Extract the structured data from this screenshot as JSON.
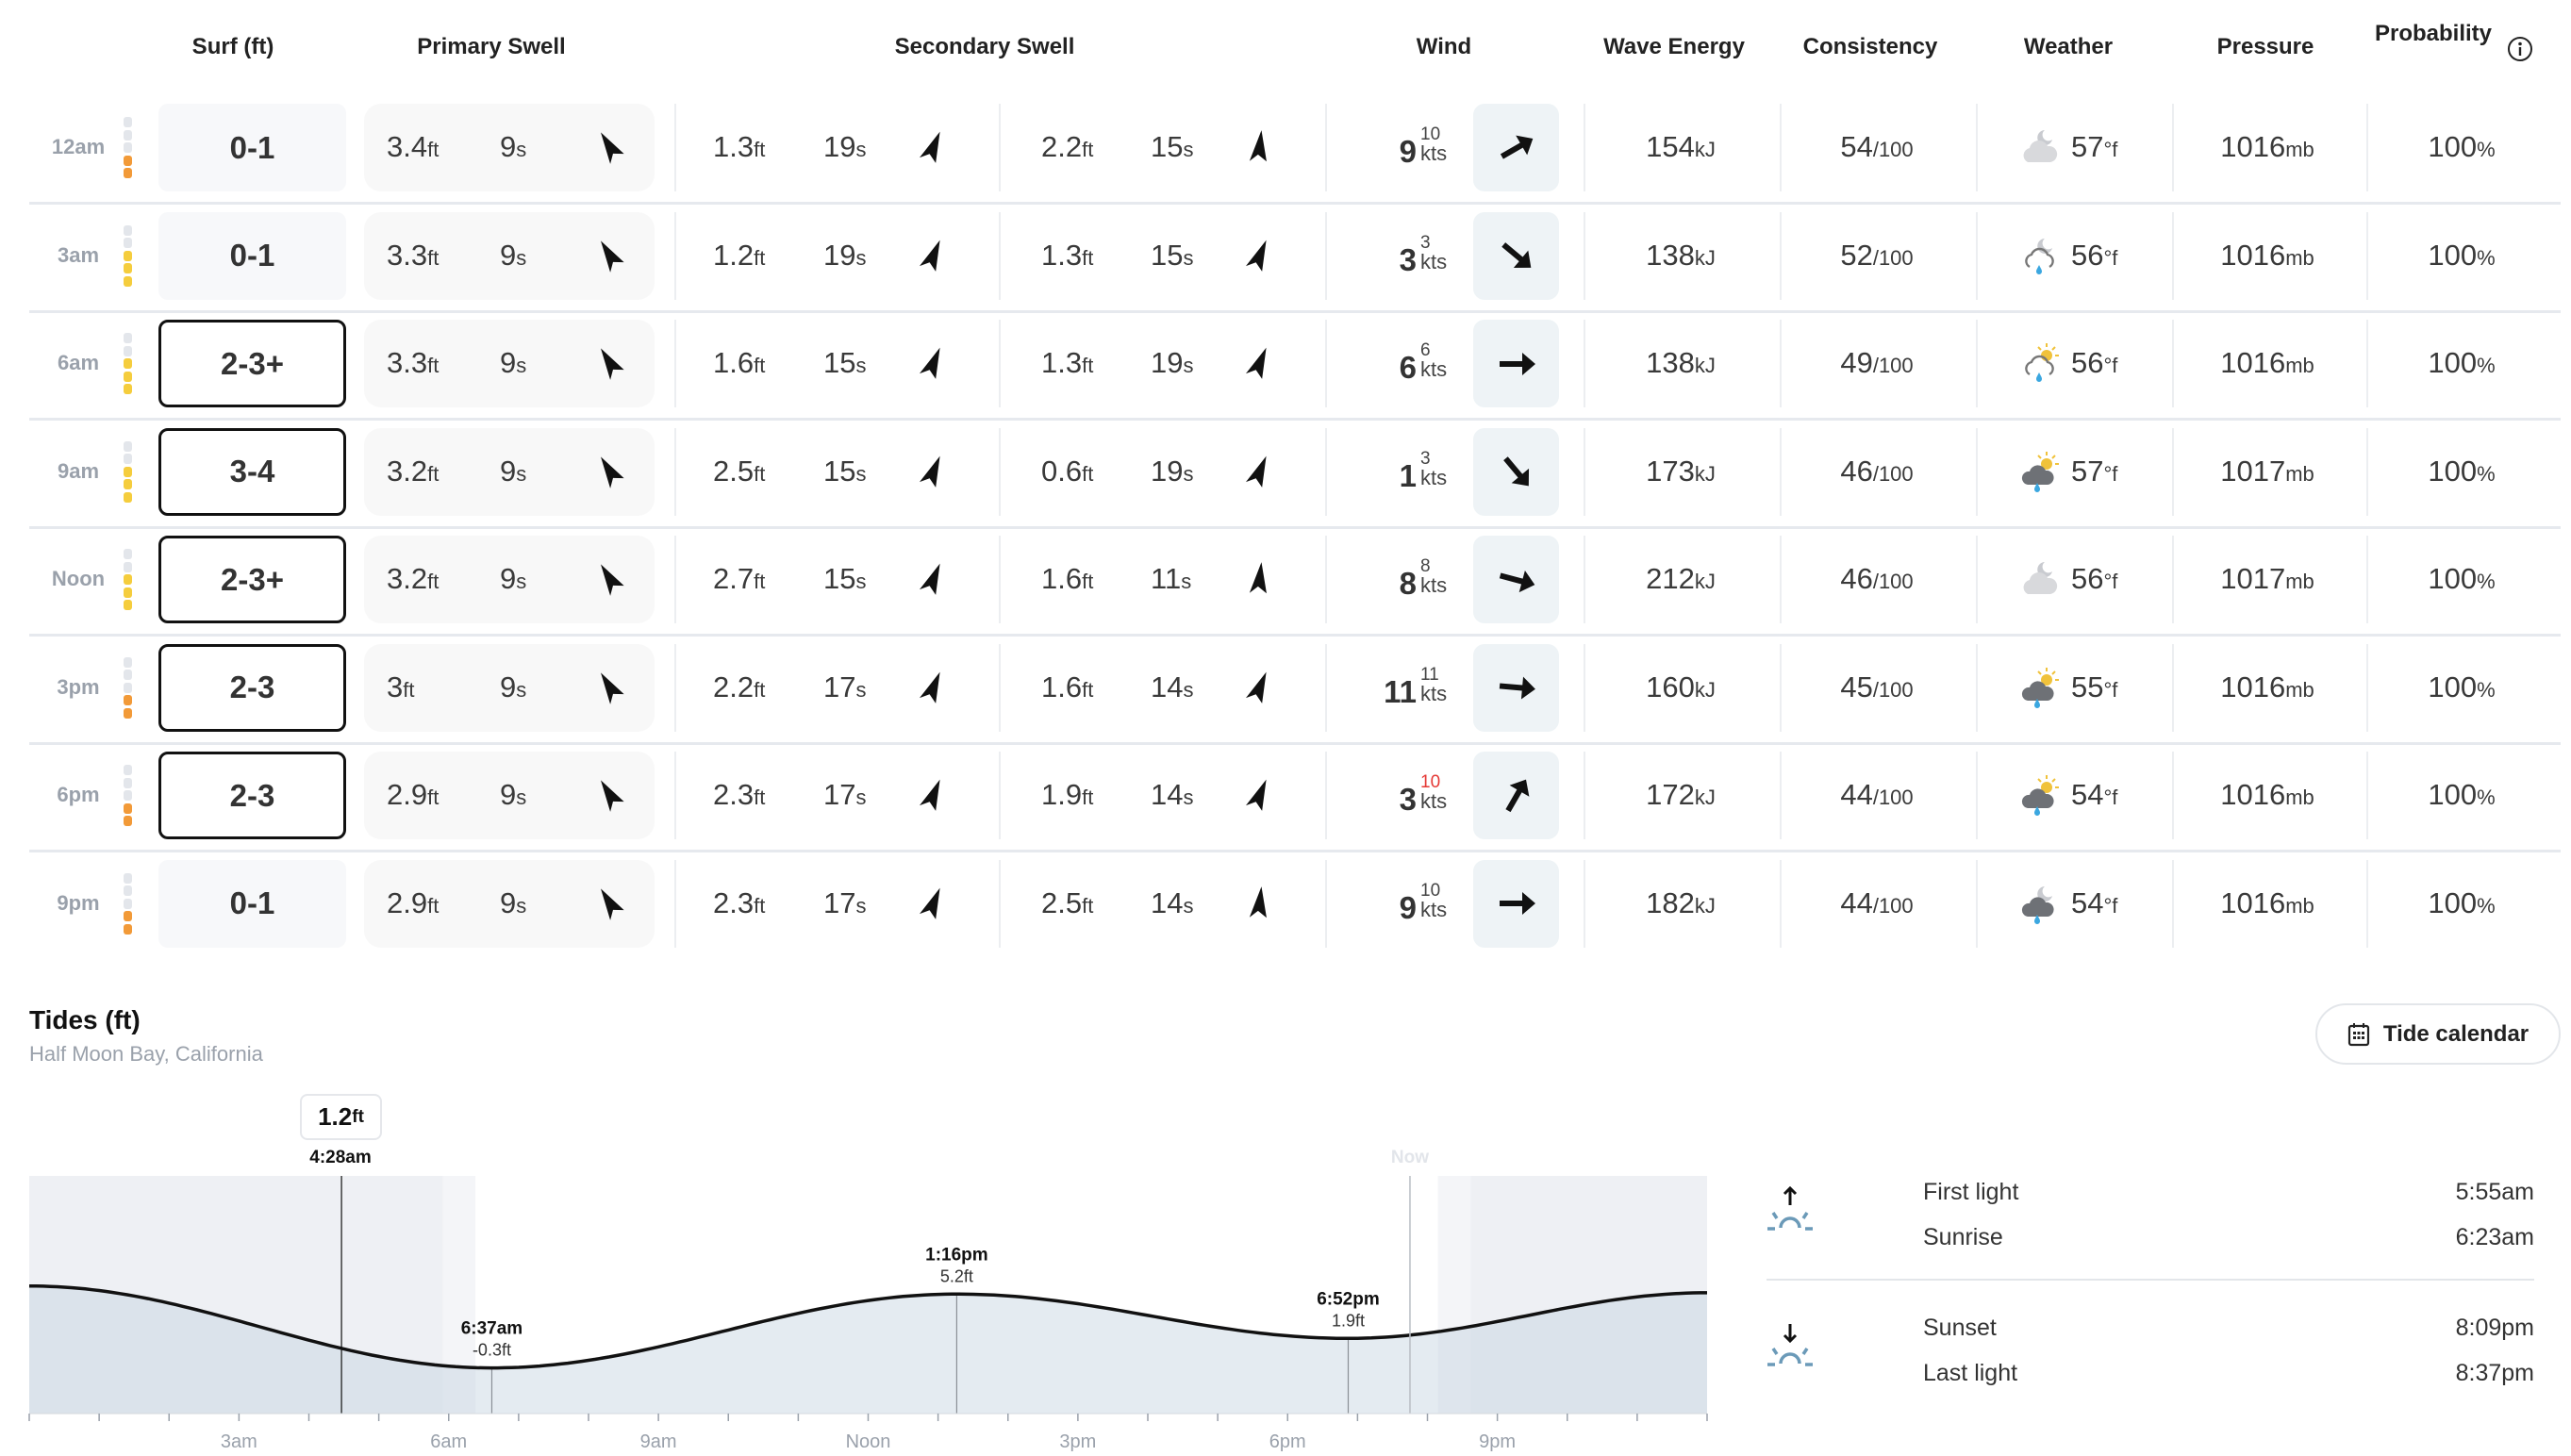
{
  "headers": {
    "surf": "Surf (ft)",
    "primary_swell": "Primary Swell",
    "secondary_swell": "Secondary Swell",
    "wind": "Wind",
    "wave_energy": "Wave Energy",
    "consistency": "Consistency",
    "weather": "Weather",
    "pressure": "Pressure",
    "probability": "Probability"
  },
  "units": {
    "ft": "ft",
    "s": "s",
    "kts": "kts",
    "kj": "kJ",
    "of100": "/100",
    "degf": "°f",
    "mb": "mb",
    "pct": "%"
  },
  "rating_colors": {
    "poor": "#f29a38",
    "fair": "#f5cd3d",
    "empty": "#e3e6eb"
  },
  "rows": [
    {
      "time": "12am",
      "rating": "poor",
      "rating_segments": 2,
      "surf": "0-1",
      "surf_boxed": false,
      "primary": {
        "height": "3.4",
        "period": "9",
        "dir": -30
      },
      "sec1": {
        "height": "1.3",
        "period": "19",
        "dir": 25
      },
      "sec2": {
        "height": "2.2",
        "period": "15",
        "dir": 8
      },
      "wind": {
        "speed": "9",
        "gust": "10",
        "gust_alert": false,
        "dir": -30
      },
      "energy": "154",
      "consistency": "54",
      "weather": {
        "icon": "cloudy-night",
        "temp": "57"
      },
      "pressure": "1016",
      "probability": "100"
    },
    {
      "time": "3am",
      "rating": "fair",
      "rating_segments": 3,
      "surf": "0-1",
      "surf_boxed": false,
      "primary": {
        "height": "3.3",
        "period": "9",
        "dir": -30
      },
      "sec1": {
        "height": "1.2",
        "period": "19",
        "dir": 25
      },
      "sec2": {
        "height": "1.3",
        "period": "15",
        "dir": 25
      },
      "wind": {
        "speed": "3",
        "gust": "3",
        "gust_alert": false,
        "dir": 40
      },
      "energy": "138",
      "consistency": "52",
      "weather": {
        "icon": "rain-night",
        "temp": "56"
      },
      "pressure": "1016",
      "probability": "100"
    },
    {
      "time": "6am",
      "rating": "fair",
      "rating_segments": 3,
      "surf": "2-3+",
      "surf_boxed": true,
      "primary": {
        "height": "3.3",
        "period": "9",
        "dir": -30
      },
      "sec1": {
        "height": "1.6",
        "period": "15",
        "dir": 25
      },
      "sec2": {
        "height": "1.3",
        "period": "19",
        "dir": 25
      },
      "wind": {
        "speed": "6",
        "gust": "6",
        "gust_alert": false,
        "dir": 0
      },
      "energy": "138",
      "consistency": "49",
      "weather": {
        "icon": "rain-day-light",
        "temp": "56"
      },
      "pressure": "1016",
      "probability": "100"
    },
    {
      "time": "9am",
      "rating": "fair",
      "rating_segments": 3,
      "surf": "3-4",
      "surf_boxed": true,
      "primary": {
        "height": "3.2",
        "period": "9",
        "dir": -30
      },
      "sec1": {
        "height": "2.5",
        "period": "15",
        "dir": 25
      },
      "sec2": {
        "height": "0.6",
        "period": "19",
        "dir": 25
      },
      "wind": {
        "speed": "1",
        "gust": "3",
        "gust_alert": false,
        "dir": 50
      },
      "energy": "173",
      "consistency": "46",
      "weather": {
        "icon": "rain-day",
        "temp": "57"
      },
      "pressure": "1017",
      "probability": "100"
    },
    {
      "time": "Noon",
      "rating": "fair",
      "rating_segments": 3,
      "surf": "2-3+",
      "surf_boxed": true,
      "primary": {
        "height": "3.2",
        "period": "9",
        "dir": -30
      },
      "sec1": {
        "height": "2.7",
        "period": "15",
        "dir": 25
      },
      "sec2": {
        "height": "1.6",
        "period": "11",
        "dir": 8
      },
      "wind": {
        "speed": "8",
        "gust": "8",
        "gust_alert": false,
        "dir": 15
      },
      "energy": "212",
      "consistency": "46",
      "weather": {
        "icon": "cloudy-night",
        "temp": "56"
      },
      "pressure": "1017",
      "probability": "100"
    },
    {
      "time": "3pm",
      "rating": "poor",
      "rating_segments": 2,
      "surf": "2-3",
      "surf_boxed": true,
      "primary": {
        "height": "3",
        "period": "9",
        "dir": -30
      },
      "sec1": {
        "height": "2.2",
        "period": "17",
        "dir": 25
      },
      "sec2": {
        "height": "1.6",
        "period": "14",
        "dir": 25
      },
      "wind": {
        "speed": "11",
        "gust": "11",
        "gust_alert": false,
        "dir": 5
      },
      "energy": "160",
      "consistency": "45",
      "weather": {
        "icon": "rain-day",
        "temp": "55"
      },
      "pressure": "1016",
      "probability": "100"
    },
    {
      "time": "6pm",
      "rating": "poor",
      "rating_segments": 2,
      "surf": "2-3",
      "surf_boxed": true,
      "primary": {
        "height": "2.9",
        "period": "9",
        "dir": -30
      },
      "sec1": {
        "height": "2.3",
        "period": "17",
        "dir": 25
      },
      "sec2": {
        "height": "1.9",
        "period": "14",
        "dir": 25
      },
      "wind": {
        "speed": "3",
        "gust": "10",
        "gust_alert": true,
        "dir": -60
      },
      "energy": "172",
      "consistency": "44",
      "weather": {
        "icon": "rain-day",
        "temp": "54"
      },
      "pressure": "1016",
      "probability": "100"
    },
    {
      "time": "9pm",
      "rating": "poor",
      "rating_segments": 2,
      "surf": "0-1",
      "surf_boxed": false,
      "primary": {
        "height": "2.9",
        "period": "9",
        "dir": -30
      },
      "sec1": {
        "height": "2.3",
        "period": "17",
        "dir": 25
      },
      "sec2": {
        "height": "2.5",
        "period": "14",
        "dir": 8
      },
      "wind": {
        "speed": "9",
        "gust": "10",
        "gust_alert": false,
        "dir": 0
      },
      "energy": "182",
      "consistency": "44",
      "weather": {
        "icon": "rain-night-dark",
        "temp": "54"
      },
      "pressure": "1016",
      "probability": "100"
    }
  ],
  "tides": {
    "title": "Tides (ft)",
    "location": "Half Moon Bay, California",
    "calendar_button": "Tide calendar",
    "hover": {
      "value": "1.2",
      "unit": "ft",
      "time": "4:28am"
    },
    "now_label": "Now",
    "sun": {
      "morning": [
        {
          "label": "First light",
          "time": "5:55am"
        },
        {
          "label": "Sunrise",
          "time": "6:23am"
        }
      ],
      "evening": [
        {
          "label": "Sunset",
          "time": "8:09pm"
        },
        {
          "label": "Last light",
          "time": "8:37pm"
        }
      ]
    }
  },
  "chart_data": {
    "type": "area",
    "title": "Tides (ft)",
    "x_ticks": [
      "3am",
      "6am",
      "9am",
      "Noon",
      "3pm",
      "6pm",
      "9pm"
    ],
    "xlim": [
      "0:00",
      "24:00"
    ],
    "ylim": [
      -3.7,
      14
    ],
    "curve": [
      {
        "time": "0:00",
        "height": 5.8
      },
      {
        "time": "6:37",
        "height": -0.3
      },
      {
        "time": "13:16",
        "height": 5.2
      },
      {
        "time": "18:52",
        "height": 1.9
      },
      {
        "time": "24:00",
        "height": 5.3
      }
    ],
    "extremes": [
      {
        "time": "6:37",
        "label": "6:37am",
        "height": "-0.3ft"
      },
      {
        "time": "13:16",
        "label": "1:16pm",
        "height": "5.2ft"
      },
      {
        "time": "18:52",
        "label": "6:52pm",
        "height": "1.9ft"
      }
    ],
    "hover_time": "4:28",
    "now_time": "19:45",
    "night_before": "5:55",
    "twilight_morning_end": "6:23",
    "twilight_evening_start": "20:09",
    "night_after": "20:37"
  }
}
